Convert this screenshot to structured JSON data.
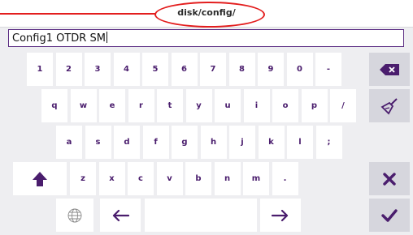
{
  "header": {
    "path": "disk/config/"
  },
  "input": {
    "value": "Config1 OTDR SM"
  },
  "keyboard": {
    "row1": [
      "1",
      "2",
      "3",
      "4",
      "5",
      "6",
      "7",
      "8",
      "9",
      "0",
      "-"
    ],
    "row2": [
      "q",
      "w",
      "e",
      "r",
      "t",
      "y",
      "u",
      "i",
      "o",
      "p",
      "/"
    ],
    "row3": [
      "a",
      "s",
      "d",
      "f",
      "g",
      "h",
      "j",
      "k",
      "l",
      ";"
    ],
    "row4": [
      "z",
      "x",
      "c",
      "v",
      "b",
      "n",
      "m",
      "."
    ]
  },
  "icons": {
    "backspace": "backspace-icon",
    "clear": "broom-icon",
    "shift": "shift-arrow-icon",
    "cancel": "close-icon",
    "confirm": "checkmark-icon",
    "language": "globe-icon",
    "left": "left-arrow-icon",
    "right": "right-arrow-icon"
  },
  "colors": {
    "accent": "#4a1d6d",
    "highlight": "#e31e1e",
    "key_bg": "#ffffff",
    "side_key_bg": "#d6d6dd",
    "page_bg": "#eeeef1"
  }
}
